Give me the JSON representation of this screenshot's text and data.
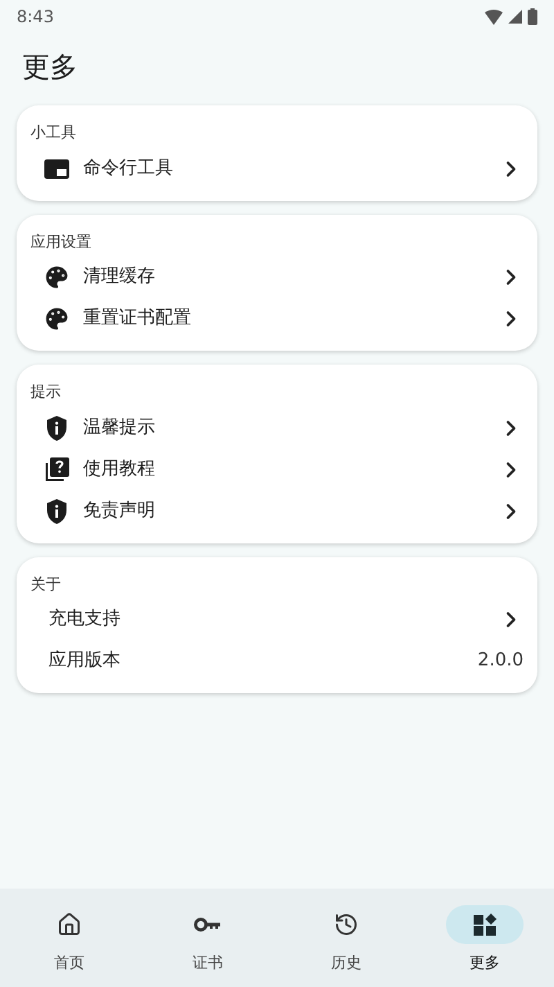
{
  "status_bar": {
    "time": "8:43"
  },
  "title": "更多",
  "sections": [
    {
      "header": "小工具",
      "items": [
        {
          "kind": "link",
          "label": "命令行工具"
        }
      ]
    },
    {
      "header": "应用设置",
      "items": [
        {
          "kind": "link",
          "label": "清理缓存"
        },
        {
          "kind": "link",
          "label": "重置证书配置"
        }
      ]
    },
    {
      "header": "提示",
      "items": [
        {
          "kind": "link",
          "label": "温馨提示"
        },
        {
          "kind": "link",
          "label": "使用教程"
        },
        {
          "kind": "link",
          "label": "免责声明"
        }
      ]
    },
    {
      "header": "关于",
      "items": [
        {
          "kind": "link",
          "label": "充电支持"
        },
        {
          "kind": "value",
          "label": "应用版本",
          "value": "2.0.0"
        }
      ]
    }
  ],
  "nav": [
    {
      "label": "首页",
      "selected": false
    },
    {
      "label": "证书",
      "selected": false
    },
    {
      "label": "历史",
      "selected": false
    },
    {
      "label": "更多",
      "selected": true
    }
  ]
}
